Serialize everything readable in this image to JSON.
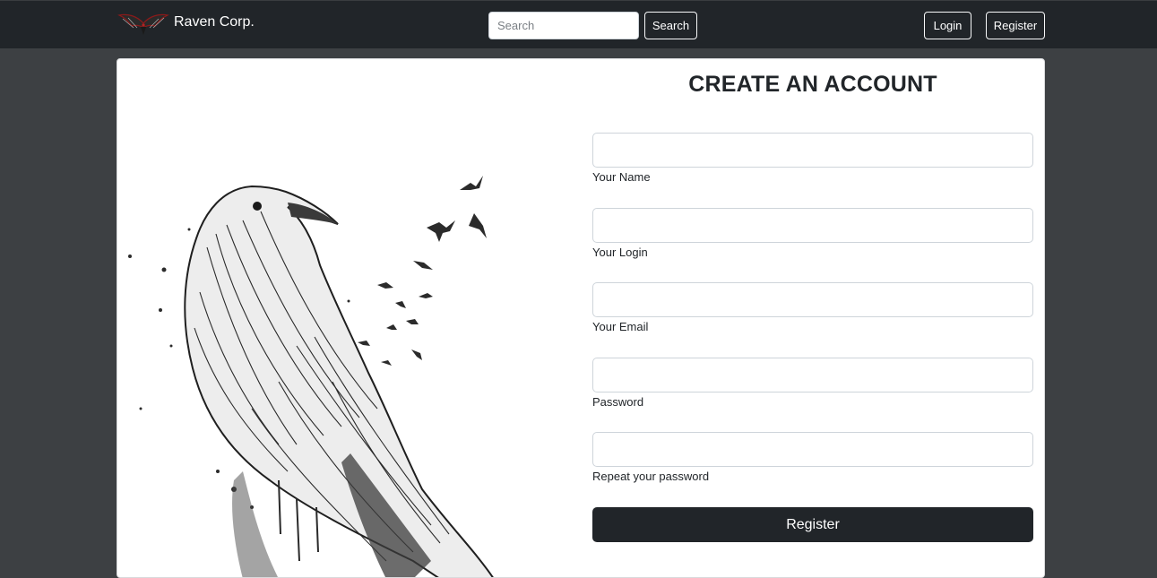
{
  "navbar": {
    "brand_text": "Raven Corp.",
    "search_placeholder": "Search",
    "search_button": "Search",
    "login_button": "Login",
    "register_button": "Register"
  },
  "form": {
    "title": "CREATE AN ACCOUNT",
    "fields": [
      {
        "label": "Your Name"
      },
      {
        "label": "Your Login"
      },
      {
        "label": "Your Email"
      },
      {
        "label": "Password"
      },
      {
        "label": "Repeat your password"
      }
    ],
    "submit_label": "Register"
  },
  "colors": {
    "page_bg": "#3d4043",
    "navbar_bg": "#212529",
    "button_dark": "#212529"
  }
}
